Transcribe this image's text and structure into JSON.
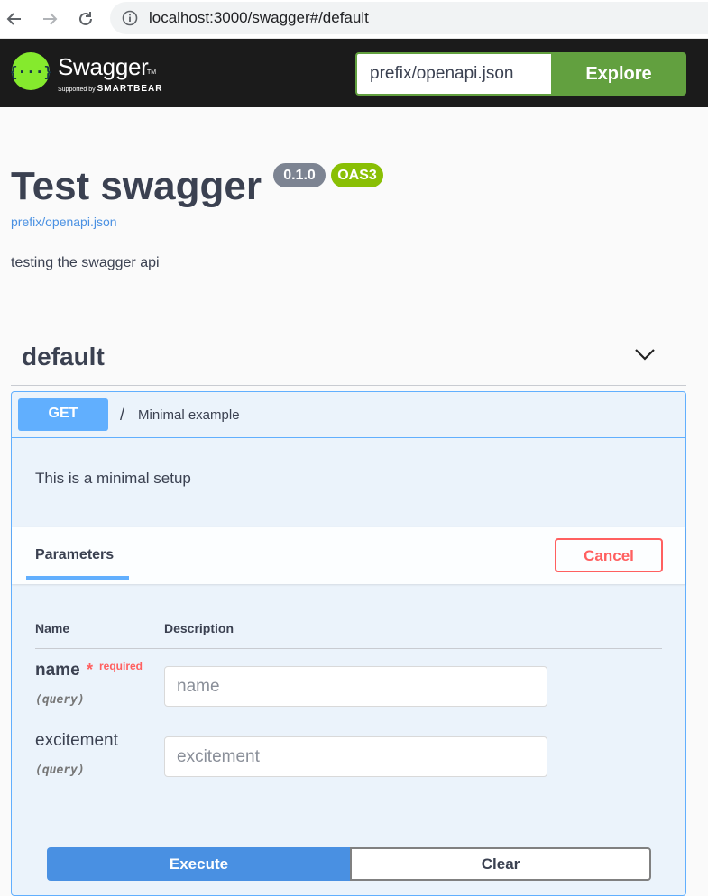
{
  "browser": {
    "url": "localhost:3000/swagger#/default",
    "icons": [
      "back-arrow-icon",
      "forward-arrow-icon",
      "reload-icon",
      "site-info-icon"
    ]
  },
  "topbar": {
    "logo_text": "Swagger",
    "logo_tm": "TM",
    "logo_sub_prefix": "Supported by",
    "logo_sub_brand": "SMARTBEAR",
    "spec_url_value": "prefix/openapi.json",
    "explore_label": "Explore"
  },
  "info": {
    "title": "Test swagger",
    "version": "0.1.0",
    "oas_badge": "OAS3",
    "spec_link": "prefix/openapi.json",
    "description": "testing the swagger api"
  },
  "tag": {
    "name": "default"
  },
  "operation": {
    "method": "GET",
    "path": "/",
    "summary": "Minimal example",
    "description": "This is a minimal setup",
    "parameters_tab": "Parameters",
    "cancel_label": "Cancel",
    "col_name": "Name",
    "col_description": "Description",
    "parameters": [
      {
        "name": "name",
        "required_mark": "*",
        "required_label": "required",
        "in": "(query)",
        "placeholder": "name"
      },
      {
        "name": "excitement",
        "in": "(query)",
        "placeholder": "excitement"
      }
    ],
    "execute_label": "Execute",
    "clear_label": "Clear"
  },
  "colors": {
    "topbar_bg": "#1b1b1b",
    "explore_green": "#62a03f",
    "get_blue": "#61affe",
    "execute_blue": "#4990e2",
    "cancel_red": "#ff6060",
    "version_badge": "#7d8492",
    "oas_badge": "#89bf04"
  }
}
